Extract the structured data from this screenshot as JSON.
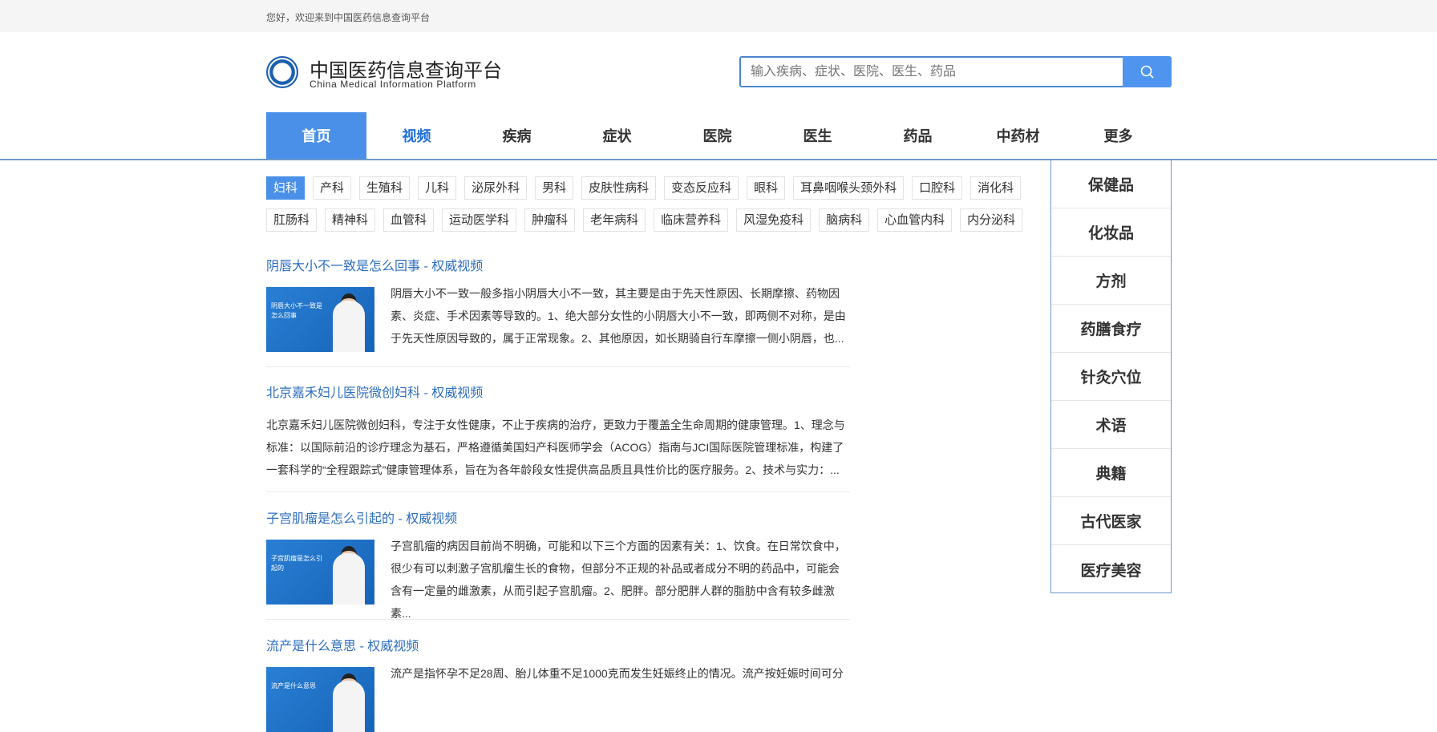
{
  "topbar": {
    "welcome": "您好，欢迎来到中国医药信息查询平台"
  },
  "header": {
    "title": "中国医药信息查询平台",
    "subtitle": "China Medical Information Platform",
    "search_placeholder": "输入疾病、症状、医院、医生、药品"
  },
  "nav": [
    "首页",
    "视频",
    "疾病",
    "症状",
    "医院",
    "医生",
    "药品",
    "中药材",
    "更多"
  ],
  "tags_row1": [
    "妇科",
    "产科",
    "生殖科",
    "儿科",
    "泌尿外科",
    "男科",
    "皮肤性病科",
    "变态反应科",
    "眼科",
    "耳鼻咽喉头颈外科",
    "口腔科",
    "消化科"
  ],
  "tags_row2": [
    "肛肠科",
    "精神科",
    "血管科",
    "运动医学科",
    "肿瘤科",
    "老年病科",
    "临床营养科",
    "风湿免疫科",
    "脑病科",
    "心血管内科",
    "内分泌科"
  ],
  "more_menu": [
    "保健品",
    "化妆品",
    "方剂",
    "药膳食疗",
    "针灸穴位",
    "术语",
    "典籍",
    "古代医家",
    "医疗美容"
  ],
  "articles": [
    {
      "title": "阴唇大小不一致是怎么回事 - 权威视频",
      "thumb": "阴唇大小不一致是怎么回事",
      "text": "阴唇大小不一致一般多指小阴唇大小不一致，其主要是由于先天性原因、长期摩擦、药物因素、炎症、手术因素等导致的。1、绝大部分女性的小阴唇大小不一致，即两侧不对称，是由于先天性原因导致的，属于正常现象。2、其他原因，如长期骑自行车摩擦一侧小阴唇，也..."
    },
    {
      "title": "北京嘉禾妇儿医院微创妇科 - 权威视频",
      "text": "北京嘉禾妇儿医院微创妇科，专注于女性健康，不止于疾病的治疗，更致力于覆盖全生命周期的健康管理。1、理念与标准：以国际前沿的诊疗理念为基石，严格遵循美国妇产科医师学会（ACOG）指南与JCI国际医院管理标准，构建了一套科学的“全程跟踪式”健康管理体系，旨在为各年龄段女性提供高品质且具性价比的医疗服务。2、技术与实力：..."
    },
    {
      "title": "子宫肌瘤是怎么引起的 - 权威视频",
      "thumb": "子宫肌瘤是怎么引起的",
      "text": "子宫肌瘤的病因目前尚不明确，可能和以下三个方面的因素有关：1、饮食。在日常饮食中，很少有可以刺激子宫肌瘤生长的食物，但部分不正规的补品或者成分不明的药品中，可能会含有一定量的雌激素，从而引起子宫肌瘤。2、肥胖。部分肥胖人群的脂肪中含有较多雌激素..."
    },
    {
      "title": "流产是什么意思 - 权威视频",
      "thumb": "流产是什么意思",
      "text": "流产是指怀孕不足28周、胎儿体重不足1000克而发生妊娠终止的情况。流产按妊娠时间可分"
    }
  ],
  "colors": {
    "accent": "#4a90e8",
    "link": "#2c6ebf"
  }
}
